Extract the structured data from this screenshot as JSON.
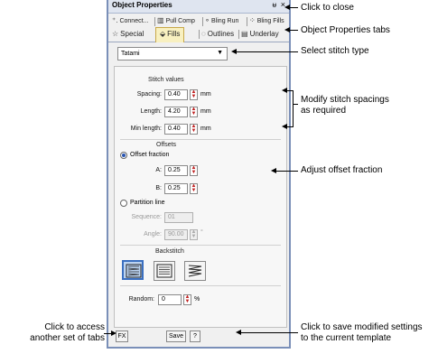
{
  "panel": {
    "title": "Object Properties",
    "pin_glyph": "ᵾ",
    "close_glyph": "×"
  },
  "tabs_row1": [
    {
      "label": "Connect...",
      "icon": "connect-icon"
    },
    {
      "label": "Pull Comp",
      "icon": "pull-comp-icon"
    },
    {
      "label": "Bling Run",
      "icon": "bling-run-icon"
    },
    {
      "label": "Bling Fills",
      "icon": "bling-fills-icon"
    }
  ],
  "tabs_row2": [
    {
      "label": "Special",
      "icon": "special-icon"
    },
    {
      "label": "Fills",
      "icon": "fills-icon",
      "active": true
    },
    {
      "label": "Outlines",
      "icon": "outlines-icon"
    },
    {
      "label": "Underlay",
      "icon": "underlay-icon"
    }
  ],
  "stitch_type": {
    "value": "Tatami"
  },
  "stitch_values": {
    "heading": "Stitch values",
    "spacing": {
      "label": "Spacing:",
      "value": "0.40",
      "unit": "mm"
    },
    "length": {
      "label": "Length:",
      "value": "4.20",
      "unit": "mm"
    },
    "min_length": {
      "label": "Min length:",
      "value": "0.40",
      "unit": "mm"
    }
  },
  "offsets": {
    "heading": "Offsets",
    "offset_fraction_label": "Offset fraction",
    "a": {
      "label": "A:",
      "value": "0.25"
    },
    "b": {
      "label": "B:",
      "value": "0.25"
    },
    "partition_line_label": "Partition line",
    "sequence": {
      "label": "Sequence:",
      "value": "01"
    },
    "angle": {
      "label": "Angle:",
      "value": "90.00",
      "unit": "°"
    }
  },
  "backstitch": {
    "heading": "Backstitch"
  },
  "random": {
    "label": "Random:",
    "value": "0",
    "unit": "%"
  },
  "footer": {
    "fx_label": "FX",
    "save_label": "Save",
    "help_label": "?"
  },
  "callouts": {
    "close": "Click to close",
    "tabs": "Object Properties tabs",
    "stitch_type": "Select stitch type",
    "spacings_1": "Modify stitch spacings",
    "spacings_2": "as required",
    "offset": "Adjust offset fraction",
    "fx_1": "Click to access",
    "fx_2": "another set of tabs",
    "save_1": "Click to save modified settings",
    "save_2": "to the current template"
  },
  "colors": {
    "panel_border": "#7a8fb8",
    "active_tab": "#f8f0c0",
    "active_backstitch": "#bcd4f2",
    "spin_arrow": "#c02020"
  }
}
